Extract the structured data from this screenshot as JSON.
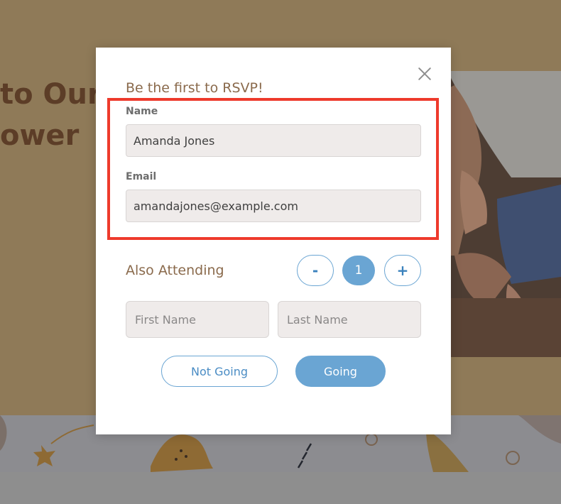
{
  "background": {
    "heading_line1": "to Our",
    "heading_line2": "ower"
  },
  "modal": {
    "heading": "Be the first to RSVP!",
    "name_label": "Name",
    "name_value": "Amanda Jones",
    "email_label": "Email",
    "email_value": "amandajones@example.com",
    "also_attending_label": "Also Attending",
    "stepper": {
      "minus": "-",
      "count": "1",
      "plus": "+"
    },
    "first_name_placeholder": "First Name",
    "last_name_placeholder": "Last Name",
    "not_going_label": "Not Going",
    "going_label": "Going"
  },
  "colors": {
    "highlight": "#ee3a2c",
    "accent_blue": "#6aa5d3",
    "heading_brown": "#8a6a4c"
  },
  "icons": {
    "close": "close-icon"
  }
}
